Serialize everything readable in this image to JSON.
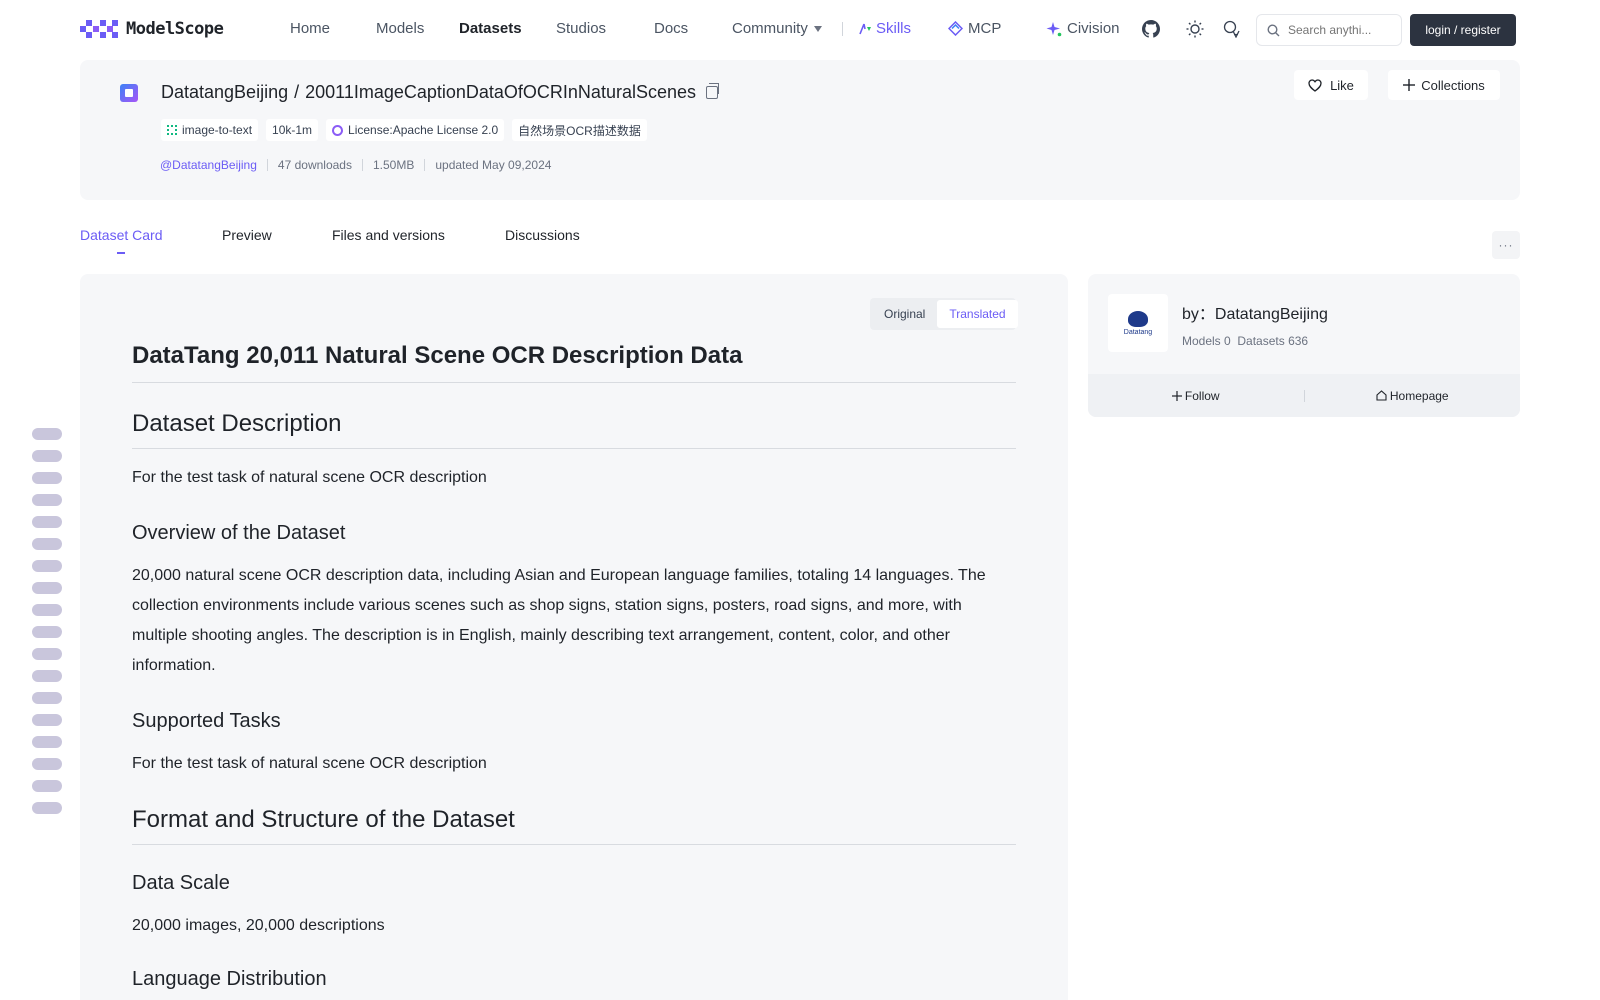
{
  "nav": {
    "logo_text": "ModelScope",
    "items": {
      "home": "Home",
      "models": "Models",
      "datasets": "Datasets",
      "studios": "Studios",
      "docs": "Docs",
      "community": "Community",
      "skills": "Skills",
      "mcp": "MCP",
      "civision": "Civision"
    },
    "search_placeholder": "Search anythi...",
    "login_label": "login / register",
    "colors": {
      "accent": "#6b5cf5",
      "login_bg": "#2c3340"
    }
  },
  "dataset": {
    "owner": "DatatangBeijing",
    "separator": "/",
    "name": "20011ImageCaptionDataOfOCRInNaturalScenes",
    "tags": {
      "task": "image-to-text",
      "size": "10k-1m",
      "license": "License:Apache License 2.0",
      "cn": "自然场景OCR描述数据"
    },
    "meta": {
      "author": "@DatatangBeijing",
      "downloads": "47 downloads",
      "filesize": "1.50MB",
      "updated": "updated May 09,2024"
    },
    "like_label": "Like",
    "collections_label": "Collections"
  },
  "tabs": {
    "card": "Dataset Card",
    "preview": "Preview",
    "files": "Files and versions",
    "discussions": "Discussions",
    "more": "···"
  },
  "toggle": {
    "original": "Original",
    "translated": "Translated"
  },
  "doc": {
    "title": "DataTang 20,011 Natural Scene OCR Description Data",
    "s1_heading": "Dataset Description",
    "s1_text": "For the test task of natural scene OCR description",
    "s2_heading": "Overview of the Dataset",
    "s2_text": "20,000 natural scene OCR description data, including Asian and European language families, totaling 14 languages. The collection environments include various scenes such as shop signs, station signs, posters, road signs, and more, with multiple shooting angles. The description is in English, mainly describing text arrangement, content, color, and other information.",
    "s3_heading": "Supported Tasks",
    "s3_text": "For the test task of natural scene OCR description",
    "s4_heading": "Format and Structure of the Dataset",
    "s5_heading": "Data Scale",
    "s5_text": "20,000 images, 20,000 descriptions",
    "s6_heading": "Language Distribution"
  },
  "author_card": {
    "logo_text": "Datatang",
    "by": "by：DatatangBeijing",
    "models": "Models 0",
    "datasets": "Datasets 636",
    "follow": "Follow",
    "homepage": "Homepage"
  },
  "icons": {
    "logo": "modelscope-logo-icon",
    "skills": "skills-icon",
    "mcp": "mcp-icon",
    "civision": "sparkle-icon",
    "github": "github-icon",
    "theme": "sun-icon",
    "language": "translate-icon",
    "search": "search-icon",
    "copy": "copy-icon",
    "like": "heart-icon",
    "collections": "plus-icon",
    "follow": "plus-icon",
    "homepage": "home-icon"
  }
}
